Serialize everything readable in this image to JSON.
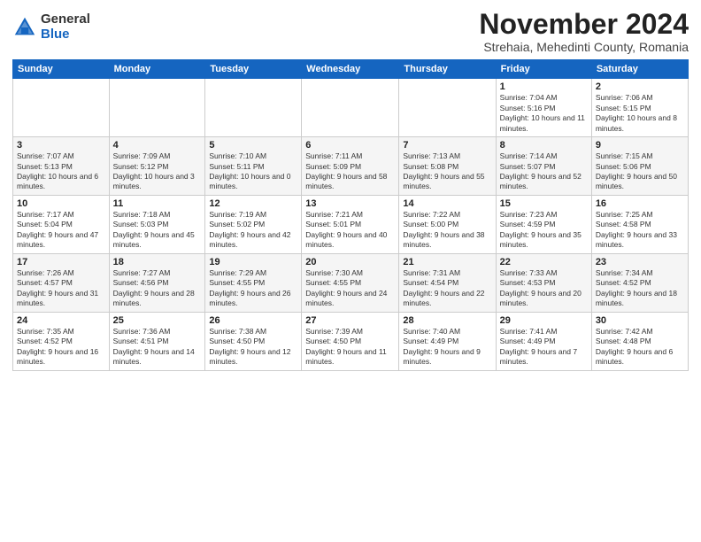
{
  "logo": {
    "general": "General",
    "blue": "Blue"
  },
  "header": {
    "month": "November 2024",
    "location": "Strehaia, Mehedinti County, Romania"
  },
  "days_of_week": [
    "Sunday",
    "Monday",
    "Tuesday",
    "Wednesday",
    "Thursday",
    "Friday",
    "Saturday"
  ],
  "weeks": [
    [
      {
        "day": "",
        "info": ""
      },
      {
        "day": "",
        "info": ""
      },
      {
        "day": "",
        "info": ""
      },
      {
        "day": "",
        "info": ""
      },
      {
        "day": "",
        "info": ""
      },
      {
        "day": "1",
        "info": "Sunrise: 7:04 AM\nSunset: 5:16 PM\nDaylight: 10 hours and 11 minutes."
      },
      {
        "day": "2",
        "info": "Sunrise: 7:06 AM\nSunset: 5:15 PM\nDaylight: 10 hours and 8 minutes."
      }
    ],
    [
      {
        "day": "3",
        "info": "Sunrise: 7:07 AM\nSunset: 5:13 PM\nDaylight: 10 hours and 6 minutes."
      },
      {
        "day": "4",
        "info": "Sunrise: 7:09 AM\nSunset: 5:12 PM\nDaylight: 10 hours and 3 minutes."
      },
      {
        "day": "5",
        "info": "Sunrise: 7:10 AM\nSunset: 5:11 PM\nDaylight: 10 hours and 0 minutes."
      },
      {
        "day": "6",
        "info": "Sunrise: 7:11 AM\nSunset: 5:09 PM\nDaylight: 9 hours and 58 minutes."
      },
      {
        "day": "7",
        "info": "Sunrise: 7:13 AM\nSunset: 5:08 PM\nDaylight: 9 hours and 55 minutes."
      },
      {
        "day": "8",
        "info": "Sunrise: 7:14 AM\nSunset: 5:07 PM\nDaylight: 9 hours and 52 minutes."
      },
      {
        "day": "9",
        "info": "Sunrise: 7:15 AM\nSunset: 5:06 PM\nDaylight: 9 hours and 50 minutes."
      }
    ],
    [
      {
        "day": "10",
        "info": "Sunrise: 7:17 AM\nSunset: 5:04 PM\nDaylight: 9 hours and 47 minutes."
      },
      {
        "day": "11",
        "info": "Sunrise: 7:18 AM\nSunset: 5:03 PM\nDaylight: 9 hours and 45 minutes."
      },
      {
        "day": "12",
        "info": "Sunrise: 7:19 AM\nSunset: 5:02 PM\nDaylight: 9 hours and 42 minutes."
      },
      {
        "day": "13",
        "info": "Sunrise: 7:21 AM\nSunset: 5:01 PM\nDaylight: 9 hours and 40 minutes."
      },
      {
        "day": "14",
        "info": "Sunrise: 7:22 AM\nSunset: 5:00 PM\nDaylight: 9 hours and 38 minutes."
      },
      {
        "day": "15",
        "info": "Sunrise: 7:23 AM\nSunset: 4:59 PM\nDaylight: 9 hours and 35 minutes."
      },
      {
        "day": "16",
        "info": "Sunrise: 7:25 AM\nSunset: 4:58 PM\nDaylight: 9 hours and 33 minutes."
      }
    ],
    [
      {
        "day": "17",
        "info": "Sunrise: 7:26 AM\nSunset: 4:57 PM\nDaylight: 9 hours and 31 minutes."
      },
      {
        "day": "18",
        "info": "Sunrise: 7:27 AM\nSunset: 4:56 PM\nDaylight: 9 hours and 28 minutes."
      },
      {
        "day": "19",
        "info": "Sunrise: 7:29 AM\nSunset: 4:55 PM\nDaylight: 9 hours and 26 minutes."
      },
      {
        "day": "20",
        "info": "Sunrise: 7:30 AM\nSunset: 4:55 PM\nDaylight: 9 hours and 24 minutes."
      },
      {
        "day": "21",
        "info": "Sunrise: 7:31 AM\nSunset: 4:54 PM\nDaylight: 9 hours and 22 minutes."
      },
      {
        "day": "22",
        "info": "Sunrise: 7:33 AM\nSunset: 4:53 PM\nDaylight: 9 hours and 20 minutes."
      },
      {
        "day": "23",
        "info": "Sunrise: 7:34 AM\nSunset: 4:52 PM\nDaylight: 9 hours and 18 minutes."
      }
    ],
    [
      {
        "day": "24",
        "info": "Sunrise: 7:35 AM\nSunset: 4:52 PM\nDaylight: 9 hours and 16 minutes."
      },
      {
        "day": "25",
        "info": "Sunrise: 7:36 AM\nSunset: 4:51 PM\nDaylight: 9 hours and 14 minutes."
      },
      {
        "day": "26",
        "info": "Sunrise: 7:38 AM\nSunset: 4:50 PM\nDaylight: 9 hours and 12 minutes."
      },
      {
        "day": "27",
        "info": "Sunrise: 7:39 AM\nSunset: 4:50 PM\nDaylight: 9 hours and 11 minutes."
      },
      {
        "day": "28",
        "info": "Sunrise: 7:40 AM\nSunset: 4:49 PM\nDaylight: 9 hours and 9 minutes."
      },
      {
        "day": "29",
        "info": "Sunrise: 7:41 AM\nSunset: 4:49 PM\nDaylight: 9 hours and 7 minutes."
      },
      {
        "day": "30",
        "info": "Sunrise: 7:42 AM\nSunset: 4:48 PM\nDaylight: 9 hours and 6 minutes."
      }
    ]
  ]
}
